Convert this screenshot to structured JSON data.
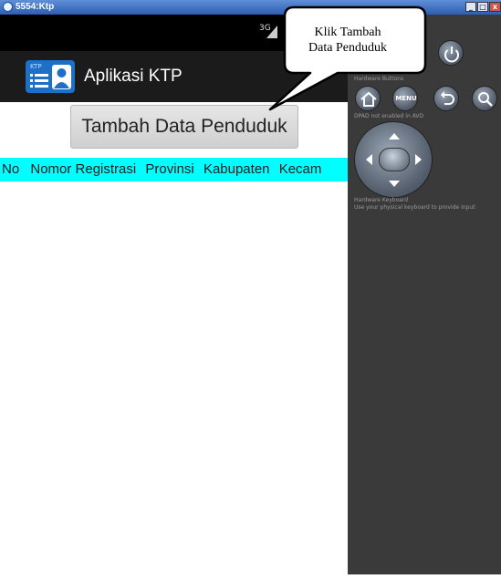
{
  "window": {
    "title": "5554:Ktp",
    "min": "_",
    "restore": "□",
    "close": "x"
  },
  "status": {
    "network": "3G"
  },
  "app": {
    "icon_badge": "KTP",
    "title": "Aplikasi KTP",
    "add_button": "Tambah Data Penduduk",
    "table_headers": [
      "No",
      "Nomor Registrasi",
      "Provinsi",
      "Kabupaten",
      "Kecam"
    ]
  },
  "emulator": {
    "hardware_buttons_label": "Hardware Buttons",
    "menu_label": "MENU",
    "dpad_label": "DPAD not enabled in AVD",
    "keyboard_title": "Hardware Keyboard",
    "keyboard_hint": "Use your physical keyboard to provide input"
  },
  "callout": {
    "line1": "Klik Tambah",
    "line2": "Data Penduduk"
  }
}
